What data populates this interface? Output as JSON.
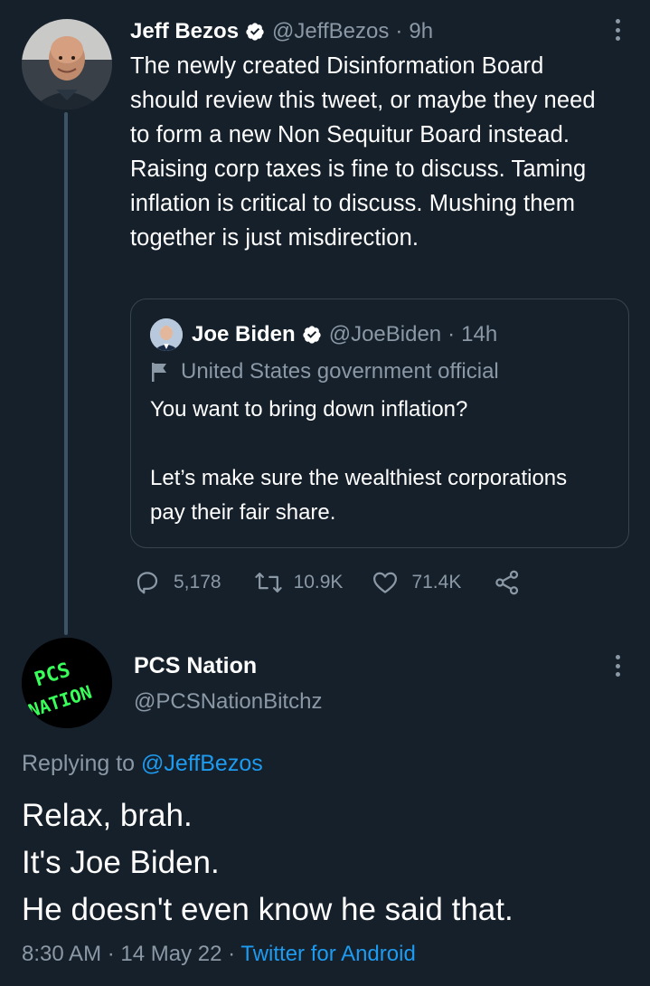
{
  "tweet": {
    "author_name": "Jeff Bezos",
    "author_handle": "@JeffBezos",
    "sep": "·",
    "time": "9h",
    "text": "The newly created Disinformation Board should review this tweet, or maybe they need to form a new Non Sequitur Board instead. Raising corp taxes is fine to discuss. Taming inflation is critical to discuss. Mushing them together is just misdirection.",
    "quoted": {
      "author_name": "Joe Biden",
      "author_handle": "@JoeBiden",
      "sep": "·",
      "time": "14h",
      "label": "United States government official",
      "line1": "You want to bring down inflation?",
      "line2": "Let’s make sure the wealthiest corporations pay their fair share."
    },
    "replies": "5,178",
    "retweets": "10.9K",
    "likes": "71.4K"
  },
  "reply": {
    "author_name": "PCS Nation",
    "author_handle": "@PCSNationBitchz",
    "avatar_text_1": "PCS",
    "avatar_text_2": "NATION",
    "replying_prefix": "Replying to ",
    "replying_to": "@JeffBezos",
    "line1": "Relax, brah.",
    "line2": "It's Joe Biden.",
    "line3": "He doesn't even know he said that.",
    "time": "8:30 AM",
    "sep1": " · ",
    "date": "14 May 22",
    "sep2": " · ",
    "source": "Twitter for Android"
  },
  "colors": {
    "background": "#15202b",
    "muted": "#8b98a5",
    "link": "#1d9bf0",
    "verified": "#ffffff",
    "avatar_text": "#39ff5a"
  }
}
